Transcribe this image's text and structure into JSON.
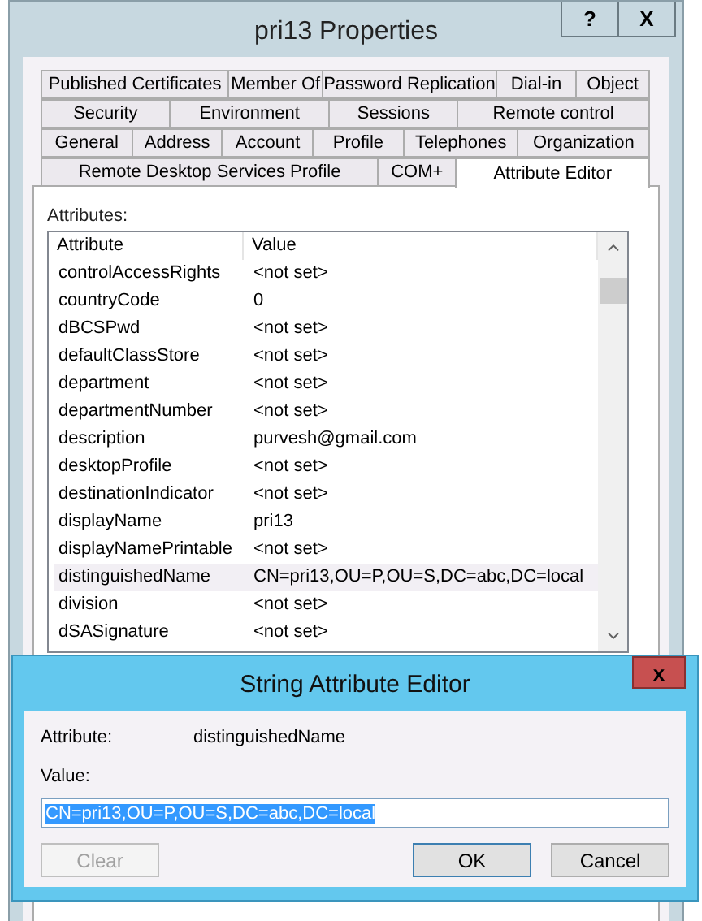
{
  "window": {
    "title": "pri13 Properties",
    "help": "?",
    "close": "X"
  },
  "tab_rows": [
    [
      {
        "label": "Published Certificates",
        "selected": false
      },
      {
        "label": "Member Of",
        "selected": false
      },
      {
        "label": "Password Replication",
        "selected": false
      },
      {
        "label": "Dial-in",
        "selected": false
      },
      {
        "label": "Object",
        "selected": false
      }
    ],
    [
      {
        "label": "Security",
        "selected": false
      },
      {
        "label": "Environment",
        "selected": false
      },
      {
        "label": "Sessions",
        "selected": false
      },
      {
        "label": "Remote control",
        "selected": false
      }
    ],
    [
      {
        "label": "General",
        "selected": false
      },
      {
        "label": "Address",
        "selected": false
      },
      {
        "label": "Account",
        "selected": false
      },
      {
        "label": "Profile",
        "selected": false
      },
      {
        "label": "Telephones",
        "selected": false
      },
      {
        "label": "Organization",
        "selected": false
      }
    ],
    [
      {
        "label": "Remote Desktop Services Profile",
        "selected": false
      },
      {
        "label": "COM+",
        "selected": false
      },
      {
        "label": "Attribute Editor",
        "selected": true
      }
    ]
  ],
  "attributes_label": "Attributes:",
  "table": {
    "columns": [
      "Attribute",
      "Value"
    ],
    "rows": [
      {
        "attribute": "controlAccessRights",
        "value": "<not set>",
        "selected": false
      },
      {
        "attribute": "countryCode",
        "value": "0",
        "selected": false
      },
      {
        "attribute": "dBCSPwd",
        "value": "<not set>",
        "selected": false
      },
      {
        "attribute": "defaultClassStore",
        "value": "<not set>",
        "selected": false
      },
      {
        "attribute": "department",
        "value": "<not set>",
        "selected": false
      },
      {
        "attribute": "departmentNumber",
        "value": "<not set>",
        "selected": false
      },
      {
        "attribute": "description",
        "value": "purvesh@gmail.com",
        "selected": false
      },
      {
        "attribute": "desktopProfile",
        "value": "<not set>",
        "selected": false
      },
      {
        "attribute": "destinationIndicator",
        "value": "<not set>",
        "selected": false
      },
      {
        "attribute": "displayName",
        "value": "pri13",
        "selected": false
      },
      {
        "attribute": "displayNamePrintable",
        "value": "<not set>",
        "selected": false
      },
      {
        "attribute": "distinguishedName",
        "value": "CN=pri13,OU=P,OU=S,DC=abc,DC=local",
        "selected": true
      },
      {
        "attribute": "division",
        "value": "<not set>",
        "selected": false
      },
      {
        "attribute": "dSASignature",
        "value": "<not set>",
        "selected": false
      }
    ]
  },
  "dialog": {
    "title": "String Attribute Editor",
    "close": "x",
    "attribute_label": "Attribute:",
    "attribute_value": "distinguishedName",
    "value_label": "Value:",
    "value": "CN=pri13,OU=P,OU=S,DC=abc,DC=local",
    "value_selected": true,
    "buttons": [
      {
        "label": "Clear",
        "disabled": true,
        "default": false
      },
      {
        "label": "OK",
        "disabled": false,
        "default": true
      },
      {
        "label": "Cancel",
        "disabled": false,
        "default": false
      }
    ]
  }
}
